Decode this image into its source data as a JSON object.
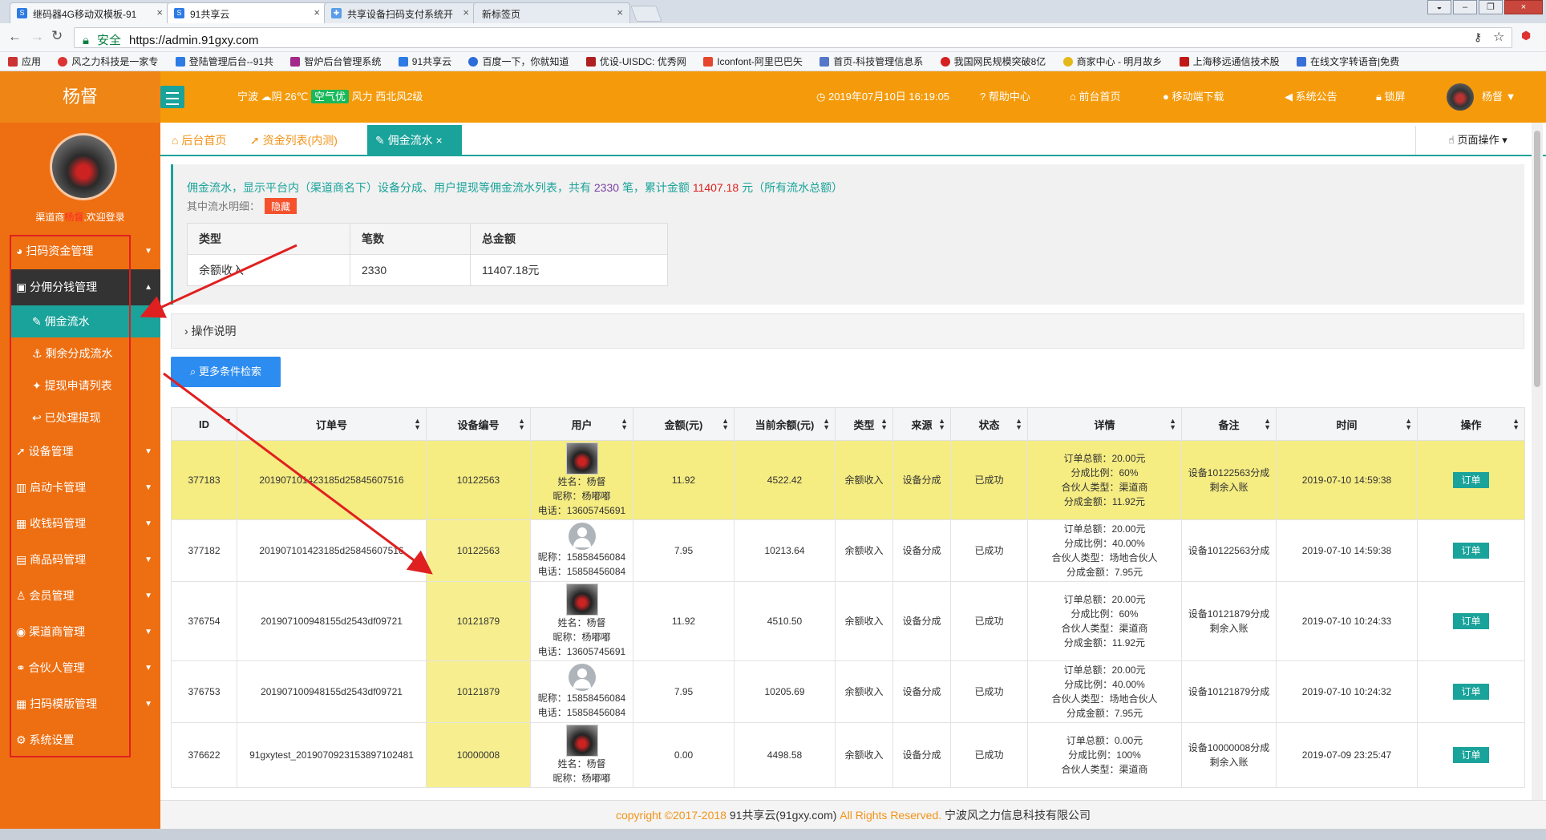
{
  "browser": {
    "tabs": [
      {
        "label": "继码器4G移动双模板-91"
      },
      {
        "label": "91共享云"
      },
      {
        "label": "共享设备扫码支付系统开"
      },
      {
        "label": "新标签页"
      }
    ],
    "secure": "安全",
    "url": "https://admin.91gxy.com",
    "bookmarks": [
      "应用",
      "风之力科技是一家专",
      "登陆管理后台--91共",
      "智炉后台管理系统",
      "91共享云",
      "百度一下，你就知道",
      "优设-UISDC: 优秀网",
      "Iconfont-阿里巴巴矢",
      "首页-科技管理信息系",
      "我国网民规模突破8亿",
      "商家中心 - 明月故乡",
      "上海移远通信技术股",
      "在线文字转语音|免费"
    ]
  },
  "header": {
    "brand": "杨督",
    "city": "宁波",
    "weather": "阴 26℃",
    "aqi": "空气优",
    "wind": "风力 西北风2级",
    "datetime": "2019年07月10日 16:19:05",
    "links": [
      "帮助中心",
      "前台首页",
      "移动端下载",
      "系统公告",
      "锁屏"
    ],
    "user": "杨督"
  },
  "sidebar": {
    "welcome_prefix": "渠道商",
    "welcome_name": "杨督",
    "welcome_suffix": ",欢迎登录",
    "items": [
      {
        "label": "扫码资金管理"
      },
      {
        "label": "分佣分钱管理"
      },
      {
        "label": "设备管理"
      },
      {
        "label": "启动卡管理"
      },
      {
        "label": "收钱码管理"
      },
      {
        "label": "商品码管理"
      },
      {
        "label": "会员管理"
      },
      {
        "label": "渠道商管理"
      },
      {
        "label": "合伙人管理"
      },
      {
        "label": "扫码模版管理"
      },
      {
        "label": "系统设置"
      }
    ],
    "sub": [
      {
        "label": "佣金流水"
      },
      {
        "label": "剩余分成流水"
      },
      {
        "label": "提现申请列表"
      },
      {
        "label": "已处理提现"
      }
    ]
  },
  "content_tabs": [
    {
      "label": "后台首页"
    },
    {
      "label": "资金列表(内测)"
    },
    {
      "label": "佣金流水"
    }
  ],
  "page_op": "页面操作",
  "info": {
    "text_a": "佣金流水，显示平台内（渠道商名下）设备分成、用户提现等佣金流水列表，共有",
    "count": "2330",
    "text_b": "笔，累计金额",
    "amount": "11407.18",
    "text_c": "元（所有流水总额）",
    "detail_label": "其中流水明细：",
    "hide_btn": "隐藏"
  },
  "summary": {
    "headers": [
      "类型",
      "笔数",
      "总金额"
    ],
    "row": [
      "余额收入",
      "2330",
      "11407.18元"
    ]
  },
  "op_explain": "操作说明",
  "more_search": "更多条件检索",
  "grid": {
    "headers": [
      "ID",
      "订单号",
      "设备编号",
      "用户",
      "金额(元)",
      "当前余额(元)",
      "类型",
      "来源",
      "状态",
      "详情",
      "备注",
      "时间",
      "操作"
    ],
    "rows": [
      {
        "id": "377183",
        "order": "201907101423185d25845607516",
        "device": "10122563",
        "avatar": "photo",
        "user": [
          "姓名：杨督",
          "昵称：杨嘟嘟",
          "电话：13605745691"
        ],
        "amount": "11.92",
        "balance": "4522.42",
        "type": "余额收入",
        "source": "设备分成",
        "status": "已成功",
        "detail": [
          "订单总额：20.00元",
          "分成比例：60%",
          "合伙人类型：渠道商",
          "分成金额：11.92元"
        ],
        "note": "设备10122563分成剩余入账",
        "time": "2019-07-10 14:59:38",
        "op": "订单"
      },
      {
        "id": "377182",
        "order": "201907101423185d25845607516",
        "device": "10122563",
        "avatar": "default",
        "user": [
          "昵称：15858456084",
          "电话：15858456084"
        ],
        "amount": "7.95",
        "balance": "10213.64",
        "type": "余额收入",
        "source": "设备分成",
        "status": "已成功",
        "detail": [
          "订单总额：20.00元",
          "分成比例：40.00%",
          "合伙人类型：场地合伙人",
          "分成金额：7.95元"
        ],
        "note": "设备10122563分成",
        "time": "2019-07-10 14:59:38",
        "op": "订单"
      },
      {
        "id": "376754",
        "order": "201907100948155d2543df09721",
        "device": "10121879",
        "avatar": "photo",
        "user": [
          "姓名：杨督",
          "昵称：杨嘟嘟",
          "电话：13605745691"
        ],
        "amount": "11.92",
        "balance": "4510.50",
        "type": "余额收入",
        "source": "设备分成",
        "status": "已成功",
        "detail": [
          "订单总额：20.00元",
          "分成比例：60%",
          "合伙人类型：渠道商",
          "分成金额：11.92元"
        ],
        "note": "设备10121879分成剩余入账",
        "time": "2019-07-10 10:24:33",
        "op": "订单"
      },
      {
        "id": "376753",
        "order": "201907100948155d2543df09721",
        "device": "10121879",
        "avatar": "default",
        "user": [
          "昵称：15858456084",
          "电话：15858456084"
        ],
        "amount": "7.95",
        "balance": "10205.69",
        "type": "余额收入",
        "source": "设备分成",
        "status": "已成功",
        "detail": [
          "订单总额：20.00元",
          "分成比例：40.00%",
          "合伙人类型：场地合伙人",
          "分成金额：7.95元"
        ],
        "note": "设备10121879分成",
        "time": "2019-07-10 10:24:32",
        "op": "订单"
      },
      {
        "id": "376622",
        "order": "91gxytest_201907092315389710248​1",
        "device": "10000008",
        "avatar": "photo",
        "user": [
          "姓名：杨督",
          "昵称：杨嘟嘟"
        ],
        "amount": "0.00",
        "balance": "4498.58",
        "type": "余额收入",
        "source": "设备分成",
        "status": "已成功",
        "detail": [
          "订单总额：0.00元",
          "分成比例：100%",
          "合伙人类型：渠道商"
        ],
        "note": "设备10000008分成剩余入账",
        "time": "2019-07-09 23:25:47",
        "op": "订单"
      }
    ]
  },
  "footer": {
    "copy": "copyright ©2017-2018",
    "site": "91共享云(91gxy.com)",
    "rights": "All Rights Reserved.",
    "company": "宁波风之力信息科技有限公司"
  },
  "colors": {
    "header": "#f59b0b",
    "sidebar": "#ee6f12",
    "accent": "#1aa39a",
    "highlight": "#f5ec82",
    "annotation": "#e02020"
  }
}
